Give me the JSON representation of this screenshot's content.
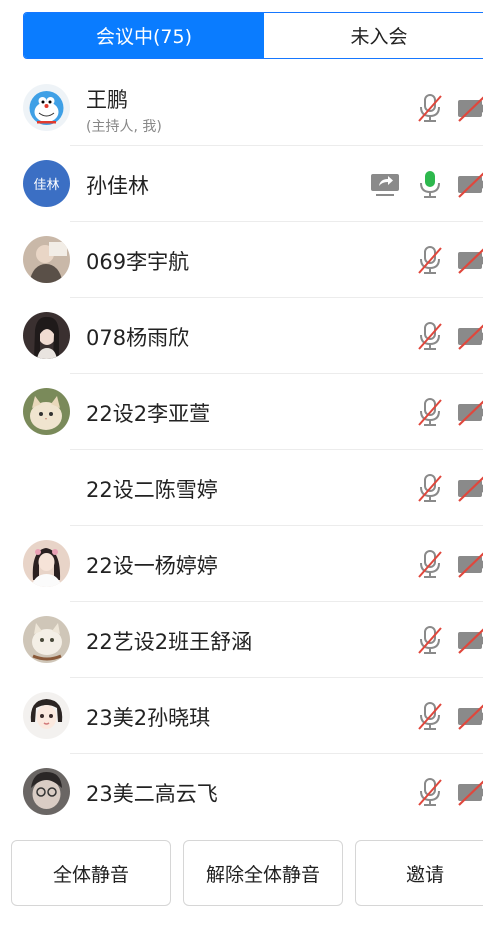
{
  "tabs": {
    "in_meeting": "会议中(75)",
    "not_joined": "未入会"
  },
  "participants": [
    {
      "name": "王鹏",
      "sub": "(主持人, 我)",
      "avatar": "cartoon-cat-avatar",
      "mic": "muted",
      "camera": "off"
    },
    {
      "name": "孙佳林",
      "avatar_text": "佳林",
      "sharing": true,
      "mic": "active",
      "camera": "off"
    },
    {
      "name": "069李宇航",
      "avatar": "photo-avatar",
      "mic": "muted",
      "camera": "off"
    },
    {
      "name": "078杨雨欣",
      "avatar": "photo-avatar",
      "mic": "muted",
      "camera": "off"
    },
    {
      "name": "22设2李亚萱",
      "avatar": "cat-photo-avatar",
      "mic": "muted",
      "camera": "off"
    },
    {
      "name": "22设二陈雪婷",
      "avatar": "none",
      "mic": "muted",
      "camera": "off"
    },
    {
      "name": "22设一杨婷婷",
      "avatar": "photo-avatar",
      "mic": "muted",
      "camera": "off"
    },
    {
      "name": "22艺设2班王舒涵",
      "avatar": "cat-photo-avatar",
      "mic": "muted",
      "camera": "off"
    },
    {
      "name": "23美2孙晓琪",
      "avatar": "illustration-avatar",
      "mic": "muted",
      "camera": "off"
    },
    {
      "name": "23美二高云飞",
      "avatar": "photo-avatar",
      "mic": "muted",
      "camera": "off"
    }
  ],
  "actions": {
    "mute_all": "全体静音",
    "unmute_all": "解除全体静音",
    "invite": "邀请"
  },
  "colors": {
    "accent": "#0a7cff",
    "mic_active": "#2db84d",
    "muted_slash": "#e0473c",
    "icon_gray": "#8a8a8a",
    "avatar_text_bg": "#3b6fc4"
  }
}
